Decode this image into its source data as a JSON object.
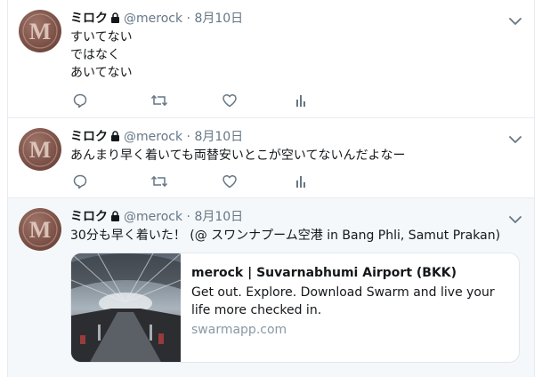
{
  "colors": {
    "accent": "#1da1f2",
    "muted": "#657786",
    "border": "#e6ecf0",
    "highlight_bg": "#f5f8fa"
  },
  "tweets": [
    {
      "name": "ミロク",
      "handle": "@merock",
      "sep": "·",
      "time": "8月10日",
      "lines": [
        "すいてない",
        "ではなく",
        "あいてない"
      ]
    },
    {
      "name": "ミロク",
      "handle": "@merock",
      "sep": "·",
      "time": "8月10日",
      "lines": [
        "あんまり早く着いても両替安いとこが空いてないんだよなー"
      ]
    },
    {
      "name": "ミロク",
      "handle": "@merock",
      "sep": "·",
      "time": "8月10日",
      "lines": [
        "30分も早く着いた！ (@ スワンナプーム空港 in Bang Phli, Samut Prakan)"
      ],
      "card": {
        "title": "merock | Suvarnabhumi Airport (BKK)",
        "description": "Get out. Explore. Download Swarm and live your life more checked in.",
        "domain": "swarmapp.com"
      }
    }
  ],
  "icons": {
    "reply": "reply-icon",
    "retweet": "retweet-icon",
    "like": "heart-icon",
    "analytics": "analytics-icon",
    "lock": "lock-icon",
    "caret": "chevron-down-icon"
  }
}
